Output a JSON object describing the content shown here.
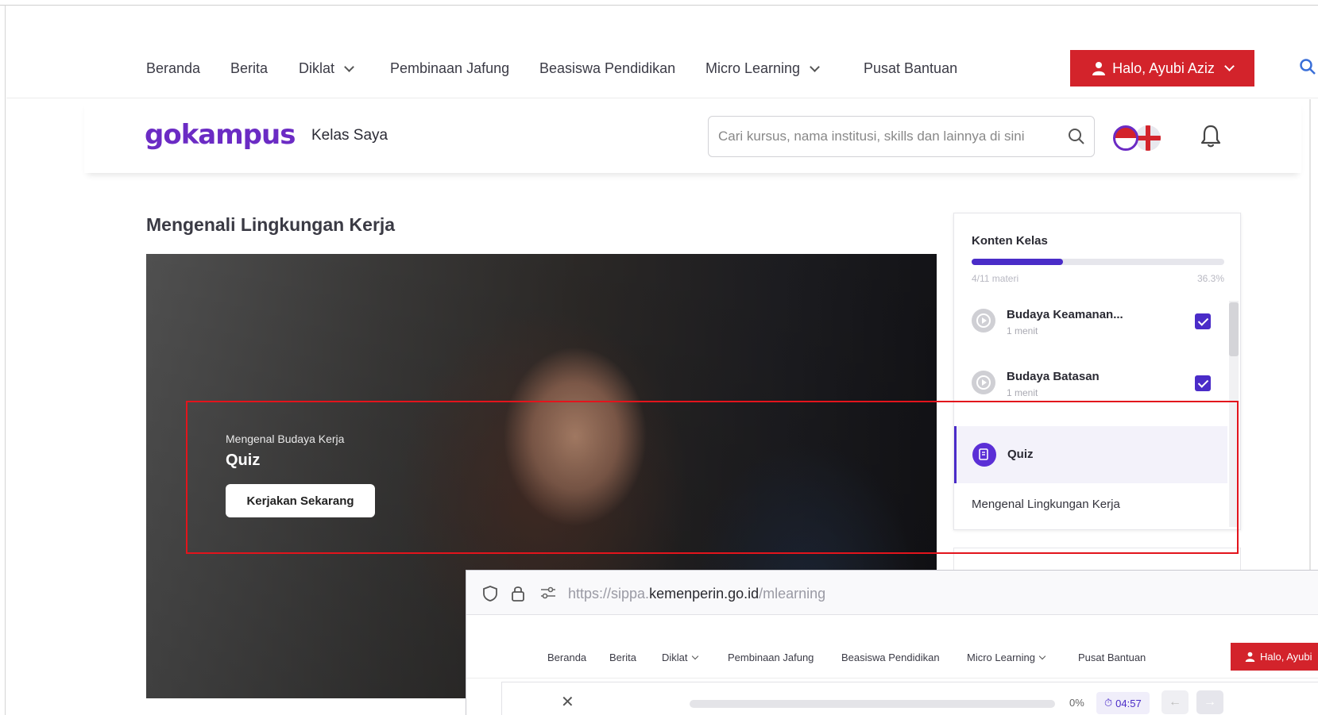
{
  "nav": {
    "items": [
      {
        "label": "Beranda"
      },
      {
        "label": "Berita"
      },
      {
        "label": "Diklat",
        "dropdown": true
      },
      {
        "label": "Pembinaan Jafung"
      },
      {
        "label": "Beasiswa Pendidikan"
      },
      {
        "label": "Micro Learning",
        "dropdown": true
      },
      {
        "label": "Pusat Bantuan"
      }
    ],
    "user_label": "Halo, Ayubi Aziz",
    "accent": "#d3232b"
  },
  "header": {
    "logo": "gokampus",
    "kelas_saya": "Kelas Saya",
    "search_placeholder": "Cari kursus, nama institusi, skills dan lainnya di sini",
    "brand_color": "#6b2bc4"
  },
  "main": {
    "title": "Mengenali Lingkungan Kerja",
    "hero": {
      "subtitle": "Mengenal Budaya Kerja",
      "title": "Quiz",
      "button_label": "Kerjakan Sekarang"
    }
  },
  "content_panel": {
    "title": "Konten Kelas",
    "progress_fraction": 0.363,
    "progress_text": "4/11 materi",
    "progress_percent": "36.3%",
    "lessons": [
      {
        "title": "Budaya Keamanan...",
        "duration": "1 menit",
        "done": true
      },
      {
        "title": "Budaya Batasan",
        "duration": "1 menit",
        "done": true
      }
    ],
    "active_item": "Quiz",
    "section_label": "Mengenal Lingkungan Kerja",
    "accent": "#4a2cc8"
  },
  "overlay_browser": {
    "url_prefix": "https://sippa.",
    "url_domain": "kemenperin.go.id",
    "url_suffix": "/mlearning",
    "nav": [
      "Beranda",
      "Berita",
      "Diklat",
      "Pembinaan Jafung",
      "Beasiswa Pendidikan",
      "Micro Learning",
      "Pusat Bantuan"
    ],
    "user_label": "Halo, Ayubi",
    "player": {
      "progress_percent": "0%",
      "time": "04:57"
    }
  }
}
